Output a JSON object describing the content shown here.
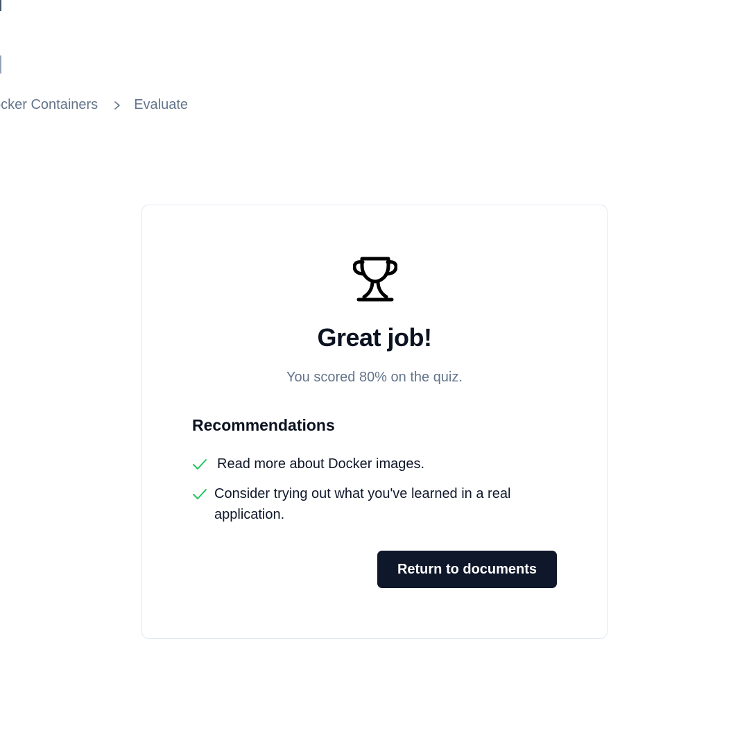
{
  "breadcrumb": {
    "items": [
      {
        "label": "ocker Containers"
      },
      {
        "label": "Evaluate"
      }
    ],
    "separator_icon": "chevron-right-icon"
  },
  "result": {
    "icon": "trophy-icon",
    "title": "Great job!",
    "subtitle": "You scored 80% on the quiz."
  },
  "recommendations": {
    "heading": "Recommendations",
    "check_icon": "check-icon",
    "check_color": "#22c55e",
    "items": [
      {
        "text": "Read more about Docker images."
      },
      {
        "text": "Consider trying out what you've learned in a real application."
      }
    ]
  },
  "actions": {
    "return_label": "Return to documents"
  },
  "colors": {
    "button_bg": "#0f172a",
    "muted_text": "#64748b",
    "card_border": "#e2e8f0"
  }
}
